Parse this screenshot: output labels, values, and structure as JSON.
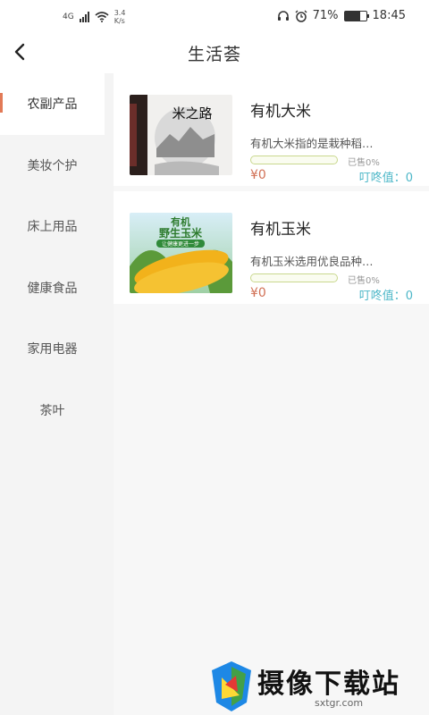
{
  "status_bar": {
    "network": "4G",
    "speed_value": "3.4",
    "speed_unit": "K/s",
    "battery": "71%",
    "battery_level": 0.71,
    "time": "18:45"
  },
  "header": {
    "title": "生活荟"
  },
  "sidebar": {
    "categories": [
      {
        "label": "农副产品",
        "active": true
      },
      {
        "label": "美妆个护",
        "active": false
      },
      {
        "label": "床上用品",
        "active": false
      },
      {
        "label": "健康食品",
        "active": false
      },
      {
        "label": "家用电器",
        "active": false
      },
      {
        "label": "茶叶",
        "active": false
      }
    ]
  },
  "products": [
    {
      "name": "有机大米",
      "desc": "有机大米指的是栽种稻…",
      "sold_label": "已售0%",
      "sold_fraction": 0,
      "price": "¥0",
      "points_label": "叮咚值：0",
      "image_text": "米之路"
    },
    {
      "name": "有机玉米",
      "desc": "有机玉米选用优良品种…",
      "sold_label": "已售0%",
      "sold_fraction": 0,
      "price": "¥0",
      "points_label": "叮咚值：0",
      "image_text_1": "有机",
      "image_text_2": "野生玉米",
      "image_text_3": "让健康更进一步"
    }
  ],
  "watermark": {
    "title": "摄像下载站",
    "url": "sxtgr.com"
  },
  "colors": {
    "accent": "#e27a57",
    "price": "#d17055",
    "points": "#4db7c8",
    "progress": "#a6c34a"
  }
}
